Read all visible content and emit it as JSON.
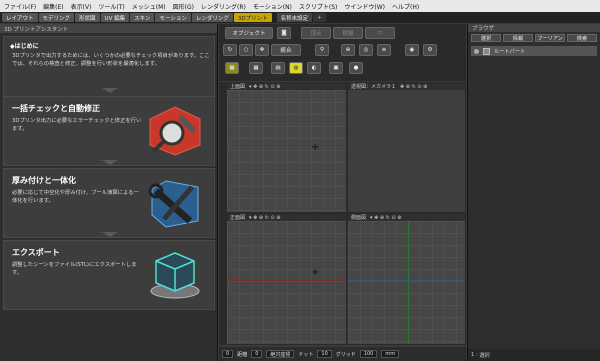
{
  "menu": [
    "ファイル(F)",
    "編集(E)",
    "表示(V)",
    "ツール(T)",
    "メッシュ(M)",
    "図形(G)",
    "レンダリング(R)",
    "モーション(N)",
    "スクリプト(S)",
    "ウインドウ(W)",
    "ヘルプ(H)"
  ],
  "tabs": [
    "レイアウト",
    "モデリング",
    "形状図",
    "UV 編集",
    "スキン",
    "モーション",
    "レンダリング",
    "3Dプリント"
  ],
  "doc_tab": "名称未設定",
  "plus_tab": "+",
  "left_panel": {
    "title": "3D プリントアシスタント",
    "intro_label": "◆はじめに",
    "intro_text": "3Dプリンタで出力するためには、いくつかの必要なチェック項目があります。ここでは、それらの検査と修正、調整を行い形状を最適化します。",
    "cards": [
      {
        "title": "一括チェックと自動修正",
        "text": "3Dプリンタ出力に必要なエラーチェックと修正を行います。"
      },
      {
        "title": "厚み付けと一体化",
        "text": "必要に応じて中空化や厚み付け、ブール演算による一体化を行います。"
      },
      {
        "title": "エクスポート",
        "text": "調整したシーンをファイル(STL)にエクスポートします。"
      }
    ]
  },
  "toolbar": {
    "object": "オブジェクト",
    "edit_a": "頂点",
    "edit_b": "稜線",
    "integrate": "統合"
  },
  "viewports": [
    {
      "label": "上面図"
    },
    {
      "label": "透視図：メカメラ１"
    },
    {
      "label": "正面図"
    },
    {
      "label": "側面図"
    }
  ],
  "status": {
    "v0": "0",
    "distance_label": "距離",
    "v1": "0",
    "coord": "絶対座標",
    "dot_label": "ドット",
    "v2": "10",
    "grid_label": "グリッド",
    "v3": "100",
    "unit": "mm"
  },
  "browser": {
    "title": "ブラウザ",
    "tabs": [
      "選択",
      "情報",
      "ブーリアン",
      "検索"
    ],
    "root": "ルートパート",
    "status_count": "1",
    "status_label": "選択"
  },
  "colors": {
    "active_tab": "#c9a400",
    "axis_red": "#7a2d2d",
    "axis_green": "#2d7a2d"
  }
}
